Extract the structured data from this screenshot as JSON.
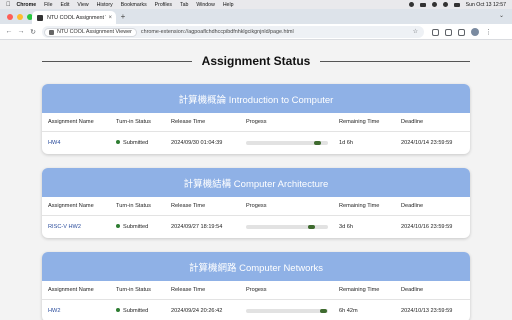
{
  "menubar": {
    "app": "Chrome",
    "menus": [
      "File",
      "Edit",
      "View",
      "History",
      "Bookmarks",
      "Profiles",
      "Tab",
      "Window",
      "Help"
    ],
    "clock": "Sun Oct 13  12:57"
  },
  "browser": {
    "tab_title": "NTU COOL Assignment Viewer",
    "omnibox_chip": "NTU COOL Assignment Viewer",
    "url": "chrome-extension://agpoaflchdhccpibdfnhklgcikgnjnld/page.html"
  },
  "page": {
    "title": "Assignment Status"
  },
  "columns": [
    "Assignment Name",
    "Turn-in Status",
    "Release Time",
    "Progess",
    "Remaining Time",
    "Deadline"
  ],
  "courses": [
    {
      "title": "計算機概論 Introduction to Computer",
      "assignments": [
        {
          "name": "HW4",
          "status": "Submitted",
          "release": "2024/09/30 01:04:39",
          "progress": 0.92,
          "remaining": "1d 6h",
          "deadline": "2024/10/14 23:59:59"
        }
      ]
    },
    {
      "title": "計算機結構 Computer Architecture",
      "assignments": [
        {
          "name": "RISC-V HW2",
          "status": "Submitted",
          "release": "2024/09/27 18:19:54",
          "progress": 0.84,
          "remaining": "3d 6h",
          "deadline": "2024/10/16 23:59:59"
        }
      ]
    },
    {
      "title": "計算機網路 Computer Networks",
      "assignments": [
        {
          "name": "HW2",
          "status": "Submitted",
          "release": "2024/09/24 20:26:42",
          "progress": 0.99,
          "remaining": "6h 42m",
          "deadline": "2024/10/13 23:59:59"
        }
      ]
    }
  ],
  "colors": {
    "card_header": "#8fb1e6",
    "progress_fill": "#3f6b2f",
    "status_dot": "#2e7d32",
    "link": "#2a4c9c"
  }
}
